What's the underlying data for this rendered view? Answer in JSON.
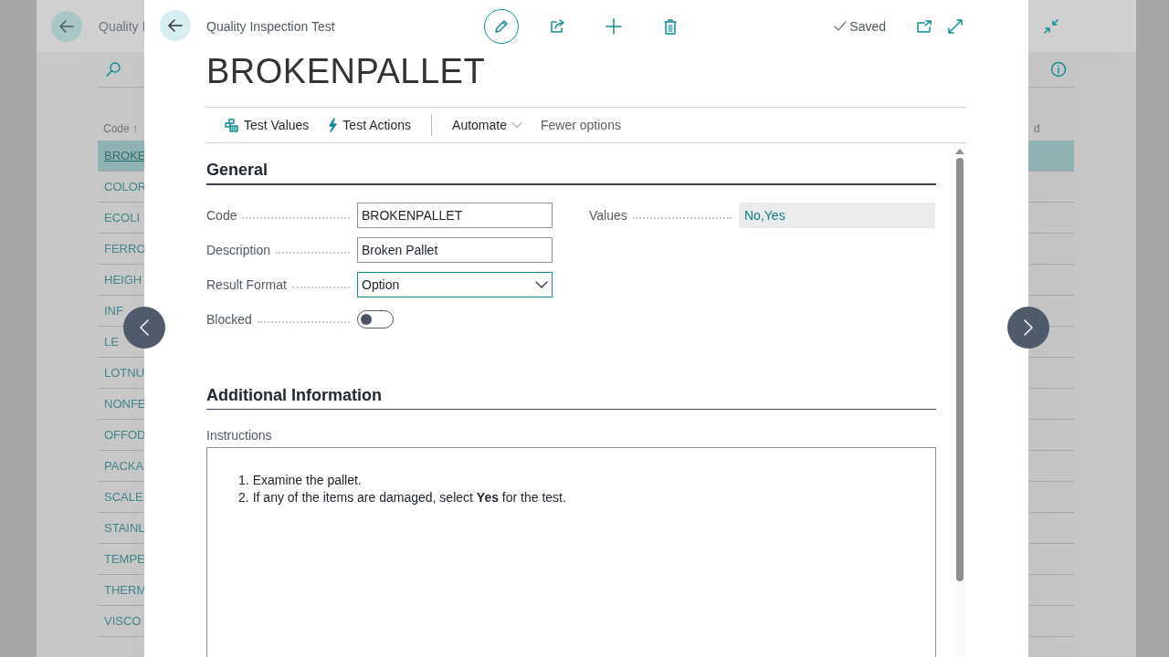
{
  "background": {
    "page_title": "Quality I",
    "column_header": "Code",
    "sort_mark": "↑",
    "column_header_2": "d",
    "rows": [
      {
        "code": "BROKE",
        "selected": true
      },
      {
        "code": "COLOR",
        "selected": false
      },
      {
        "code": "ECOLI",
        "selected": false
      },
      {
        "code": "FERRO",
        "selected": false
      },
      {
        "code": "HEIGH",
        "selected": false
      },
      {
        "code": "INF",
        "selected": false
      },
      {
        "code": "LE",
        "selected": false
      },
      {
        "code": "LOTNU",
        "selected": false
      },
      {
        "code": "NONFE",
        "selected": false
      },
      {
        "code": "OFFOD",
        "selected": false
      },
      {
        "code": "PACKA",
        "selected": false
      },
      {
        "code": "SCALE",
        "selected": false
      },
      {
        "code": "STAINL",
        "selected": false
      },
      {
        "code": "TEMPE",
        "selected": false
      },
      {
        "code": "THERM",
        "selected": false
      },
      {
        "code": "VISCO",
        "selected": false
      }
    ]
  },
  "dialog": {
    "caption": "Quality Inspection Test",
    "saved": "Saved",
    "title": "BROKENPALLET",
    "actions": [
      {
        "kind": "test-values",
        "label": "Test Values"
      },
      {
        "kind": "test-actions",
        "label": "Test Actions"
      },
      {
        "kind": "menu",
        "label": "Automate"
      },
      {
        "kind": "plain",
        "label": "Fewer options"
      }
    ],
    "general": {
      "heading": "General",
      "left_fields": [
        {
          "kind": "text",
          "label": "Code",
          "value": "BROKENPALLET",
          "focused": false
        },
        {
          "kind": "text",
          "label": "Description",
          "value": "Broken Pallet",
          "focused": false
        },
        {
          "kind": "select",
          "label": "Result Format",
          "value": "Option",
          "focused": true
        },
        {
          "kind": "toggle",
          "label": "Blocked",
          "on": false
        }
      ],
      "right_fields": [
        {
          "kind": "readonly",
          "label": "Values",
          "value": "No,Yes"
        }
      ]
    },
    "additional": {
      "heading": "Additional Information",
      "label": "Instructions",
      "items": [
        {
          "number": "1.",
          "text": "Examine the pallet."
        },
        {
          "number": "2.",
          "text": "If any of the items are damaged, select **Yes** for the test."
        }
      ]
    }
  }
}
